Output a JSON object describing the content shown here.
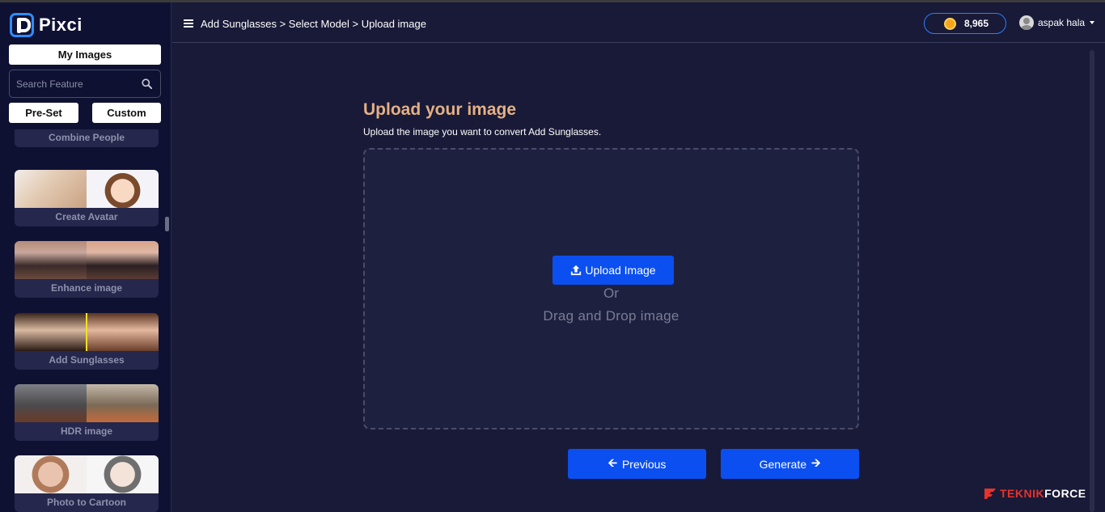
{
  "app": {
    "name": "Pixci"
  },
  "sidebar": {
    "my_images_label": "My Images",
    "search_placeholder": "Search Feature",
    "preset_label": "Pre-Set",
    "custom_label": "Custom",
    "features": [
      {
        "label": "Combine People"
      },
      {
        "label": "Create Avatar"
      },
      {
        "label": "Enhance image"
      },
      {
        "label": "Add Sunglasses"
      },
      {
        "label": "HDR image"
      },
      {
        "label": "Photo to Cartoon"
      }
    ]
  },
  "header": {
    "breadcrumb": "Add Sunglasses > Select Model > Upload image",
    "coins": "8,965",
    "username": "aspak hala"
  },
  "main": {
    "title": "Upload your image",
    "subtitle": "Upload the image you want to convert Add Sunglasses.",
    "upload_button": "Upload Image",
    "or_text": "Or",
    "drag_text": "Drag and Drop image",
    "previous_button": "Previous",
    "generate_button": "Generate"
  },
  "watermark": {
    "part1": "TEKNIK",
    "part2": "FORCE"
  },
  "colors": {
    "accent": "#0b4ff0",
    "title": "#e5b083",
    "background": "#181a38",
    "sidebar": "#0f1133"
  }
}
